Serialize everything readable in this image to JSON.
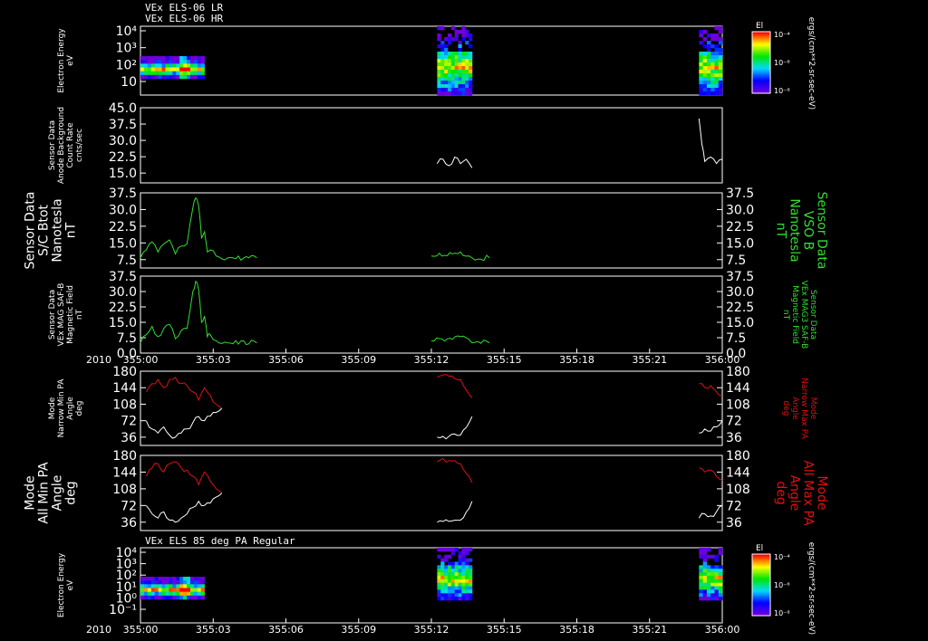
{
  "colors": {
    "background": "#000000",
    "axis": "#ffffff",
    "white_series": "#ffffff",
    "green_series": "#33dd33",
    "red_series": "#dd1111"
  },
  "header": {
    "line1": "VEx ELS-06 LR",
    "line2": "VEx ELS-06 HR"
  },
  "colorbar": {
    "title": "El",
    "tick_top": "10⁻⁴",
    "tick_mid": "10⁻⁶",
    "tick_bottom": "10⁻⁸",
    "unit_label": "ergs/(cm**2-sr-sec-eV)"
  },
  "time_axis": {
    "year": "2010",
    "ticks": [
      "355:00",
      "355:03",
      "355:06",
      "355:09",
      "355:12",
      "355:15",
      "355:18",
      "355:21",
      "356:00"
    ]
  },
  "chart_data": [
    {
      "type": "heatmap",
      "id": "panel1",
      "ylabel": "Electron Energy\neV",
      "yscale": "log",
      "ylim": [
        1,
        15000
      ],
      "yticks": [
        "10⁴",
        "10³",
        "10²",
        "10"
      ],
      "colorscale": "rainbow",
      "blocks_time_range": [
        [
          0.0,
          0.11
        ],
        [
          0.51,
          0.57
        ],
        [
          0.96,
          1.0
        ]
      ]
    },
    {
      "type": "line",
      "id": "panel2",
      "ylabel": "Sensor Data\nAnode Background\nCount Rate\ncnts/sec",
      "ylim": [
        10,
        45
      ],
      "yticks": [
        "45.0",
        "37.5",
        "30.0",
        "22.5",
        "15.0"
      ],
      "series": [
        {
          "color": "#ffffff",
          "x": [
            0.51,
            0.52,
            0.53,
            0.54,
            0.55,
            0.56,
            0.57,
            0.96,
            0.965,
            0.97,
            0.98,
            0.99,
            1.0
          ],
          "y": [
            19,
            21,
            18,
            22,
            19,
            21,
            17,
            40,
            28,
            20,
            22,
            19,
            21
          ]
        }
      ]
    },
    {
      "type": "line",
      "id": "panel3",
      "ylabel": "Sensor Data\nS/C Btot\nNanotesla\nnT",
      "ylabel_right": "Sensor Data\nVSO B\nNanotesla\nnT",
      "ylim": [
        0,
        37.5
      ],
      "yticks": [
        "37.5",
        "30.0",
        "22.5",
        "15.0",
        "7.5"
      ],
      "series": [
        {
          "color": "#33dd33",
          "x": [
            0.0,
            0.01,
            0.02,
            0.03,
            0.04,
            0.05,
            0.06,
            0.07,
            0.08,
            0.09,
            0.095,
            0.1,
            0.105,
            0.11,
            0.115,
            0.12,
            0.13,
            0.15,
            0.2,
            0.3,
            0.4,
            0.5,
            0.55,
            0.57,
            0.6,
            0.7,
            0.8,
            0.9,
            1.0
          ],
          "y": [
            5,
            9,
            13,
            8,
            12,
            14,
            7,
            11,
            12,
            30,
            35,
            31,
            15,
            18,
            8,
            9,
            6,
            5,
            5,
            5.5,
            5,
            6,
            8,
            5,
            5,
            5,
            4.5,
            5,
            5
          ]
        }
      ]
    },
    {
      "type": "line",
      "id": "panel4",
      "ylabel": "Sensor Data\nVEx MAG SAF-B\nMagnetic Field\nnT",
      "ylabel_right": "Sensor Data\nVEx MAG3 SAF-B\nMagnetic Field\nnT",
      "ylim": [
        0,
        37.5
      ],
      "yticks": [
        "37.5",
        "30.0",
        "22.5",
        "15.0",
        "7.5",
        "0.0"
      ],
      "series": [
        {
          "color": "#33dd33",
          "x": [
            0.0,
            0.01,
            0.02,
            0.03,
            0.04,
            0.05,
            0.06,
            0.07,
            0.08,
            0.09,
            0.095,
            0.1,
            0.105,
            0.11,
            0.115,
            0.12,
            0.13,
            0.15,
            0.2,
            0.3,
            0.4,
            0.5,
            0.55,
            0.57,
            0.6,
            0.7,
            0.8,
            0.9,
            1.0
          ],
          "y": [
            5,
            9,
            13,
            8,
            12,
            14,
            7,
            11,
            12,
            30,
            35,
            31,
            15,
            18,
            8,
            9,
            6,
            5,
            5,
            5.5,
            5,
            6,
            8,
            5,
            5,
            5,
            4.5,
            5,
            5
          ]
        }
      ]
    },
    {
      "type": "line",
      "id": "panel5",
      "ylabel": "Mode\nNarrow Min PA\nAngle\ndeg",
      "ylabel_right": "Mode\nNarrow Max PA\nAngle\ndeg",
      "ylim": [
        0,
        180
      ],
      "yticks": [
        "180",
        "144",
        "108",
        "72",
        "36"
      ],
      "series": [
        {
          "name": "Min",
          "color": "#ffffff",
          "x": [
            0.01,
            0.02,
            0.03,
            0.04,
            0.05,
            0.06,
            0.07,
            0.08,
            0.09,
            0.1,
            0.11,
            0.13,
            0.14,
            0.51,
            0.53,
            0.55,
            0.57,
            0.96,
            0.97,
            0.98,
            0.99,
            1.0
          ],
          "y": [
            60,
            40,
            30,
            45,
            25,
            20,
            30,
            40,
            55,
            70,
            60,
            80,
            90,
            20,
            22,
            25,
            70,
            30,
            40,
            35,
            45,
            60
          ]
        },
        {
          "name": "Max",
          "color": "#dd1111",
          "x": [
            0.01,
            0.02,
            0.03,
            0.04,
            0.05,
            0.06,
            0.07,
            0.08,
            0.09,
            0.1,
            0.11,
            0.13,
            0.14,
            0.51,
            0.53,
            0.55,
            0.57,
            0.96,
            0.97,
            0.98,
            0.99,
            1.0
          ],
          "y": [
            130,
            150,
            160,
            140,
            160,
            165,
            150,
            145,
            130,
            110,
            140,
            100,
            90,
            165,
            168,
            160,
            115,
            150,
            140,
            145,
            130,
            120
          ]
        }
      ]
    },
    {
      "type": "line",
      "id": "panel6",
      "ylabel": "Mode\nAll Min PA\nAngle\ndeg",
      "ylabel_right": "Mode\nAll Max PA\nAngle\ndeg",
      "ylim": [
        0,
        180
      ],
      "yticks": [
        "180",
        "144",
        "108",
        "72",
        "36"
      ],
      "series": [
        {
          "name": "Min",
          "color": "#ffffff",
          "x": [
            0.01,
            0.02,
            0.03,
            0.04,
            0.05,
            0.06,
            0.07,
            0.08,
            0.09,
            0.1,
            0.11,
            0.13,
            0.14,
            0.51,
            0.53,
            0.55,
            0.57,
            0.96,
            0.97,
            0.98,
            0.99,
            1.0
          ],
          "y": [
            60,
            40,
            30,
            45,
            25,
            20,
            30,
            40,
            55,
            70,
            60,
            80,
            90,
            20,
            22,
            25,
            70,
            30,
            40,
            35,
            45,
            60
          ]
        },
        {
          "name": "Max",
          "color": "#dd1111",
          "x": [
            0.01,
            0.02,
            0.03,
            0.04,
            0.05,
            0.06,
            0.07,
            0.08,
            0.09,
            0.1,
            0.11,
            0.13,
            0.14,
            0.51,
            0.53,
            0.55,
            0.57,
            0.96,
            0.97,
            0.98,
            0.99,
            1.0
          ],
          "y": [
            130,
            150,
            160,
            140,
            160,
            165,
            150,
            145,
            130,
            110,
            140,
            100,
            90,
            165,
            168,
            160,
            115,
            150,
            140,
            145,
            130,
            120
          ]
        }
      ]
    },
    {
      "type": "heatmap",
      "id": "panel7",
      "title": "VEx ELS 85 deg PA Regular",
      "ylabel": "Electron Energy\neV",
      "yscale": "log",
      "ylim": [
        1,
        15000
      ],
      "yticks": [
        "10⁴",
        "10³",
        "10²",
        "10¹",
        "10⁰",
        "10⁻¹"
      ],
      "colorscale": "rainbow",
      "blocks_time_range": [
        [
          0.0,
          0.11
        ],
        [
          0.51,
          0.57
        ],
        [
          0.96,
          1.0
        ]
      ]
    }
  ]
}
